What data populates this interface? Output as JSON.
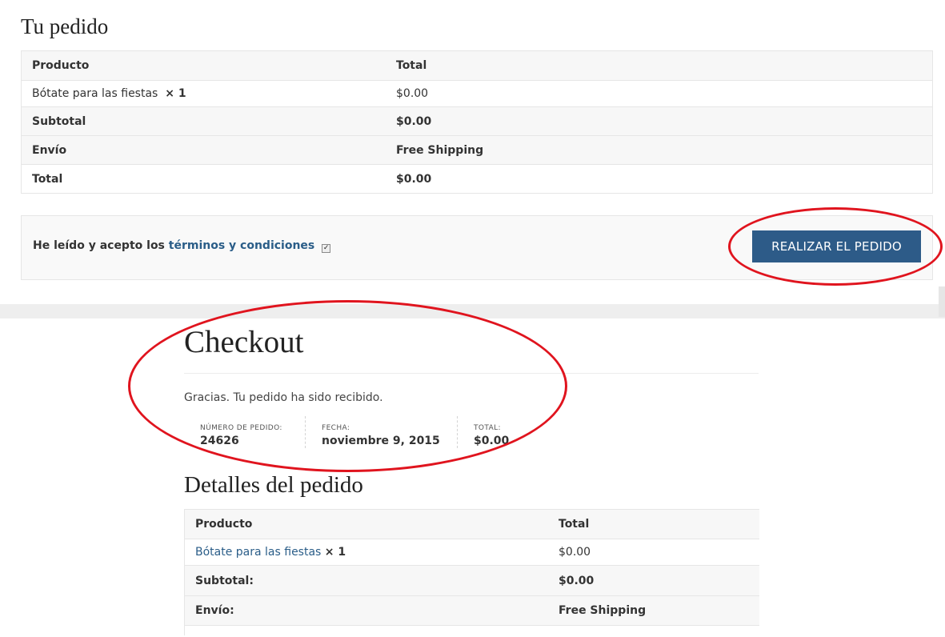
{
  "review": {
    "title": "Tu pedido",
    "columns": [
      "Producto",
      "Total"
    ],
    "item": {
      "name": "Bótate para las fiestas",
      "qty": "× 1",
      "total": "$0.00"
    },
    "subtotal": {
      "label": "Subtotal",
      "value": "$0.00"
    },
    "shipping": {
      "label": "Envío",
      "value": "Free Shipping"
    },
    "total": {
      "label": "Total",
      "value": "$0.00"
    }
  },
  "place_order": {
    "terms_prefix": "He leído y acepto los ",
    "terms_link": "términos y condiciones",
    "terms_checked": true,
    "button_label": "REALIZAR EL PEDIDO",
    "button_color": "#2d5b88"
  },
  "checkout": {
    "title": "Checkout",
    "thanks": "Gracias. Tu pedido ha sido recibido.",
    "overview": {
      "number_label": "NÚMERO DE PEDIDO:",
      "number_value": "24626",
      "date_label": "FECHA:",
      "date_value": "noviembre 9, 2015",
      "total_label": "TOTAL:",
      "total_value": "$0.00"
    }
  },
  "details": {
    "title": "Detalles del pedido",
    "columns": [
      "Producto",
      "Total"
    ],
    "item": {
      "name": "Bótate para las fiestas",
      "qty": "× 1",
      "total": "$0.00"
    },
    "subtotal": {
      "label": "Subtotal:",
      "value": "$0.00"
    },
    "shipping": {
      "label": "Envío:",
      "value": "Free Shipping"
    }
  },
  "colors": {
    "link": "#2a5d88",
    "annotation": "#e0141e"
  },
  "icons": {
    "terms_checkbox": "checkbox-checked-icon"
  }
}
